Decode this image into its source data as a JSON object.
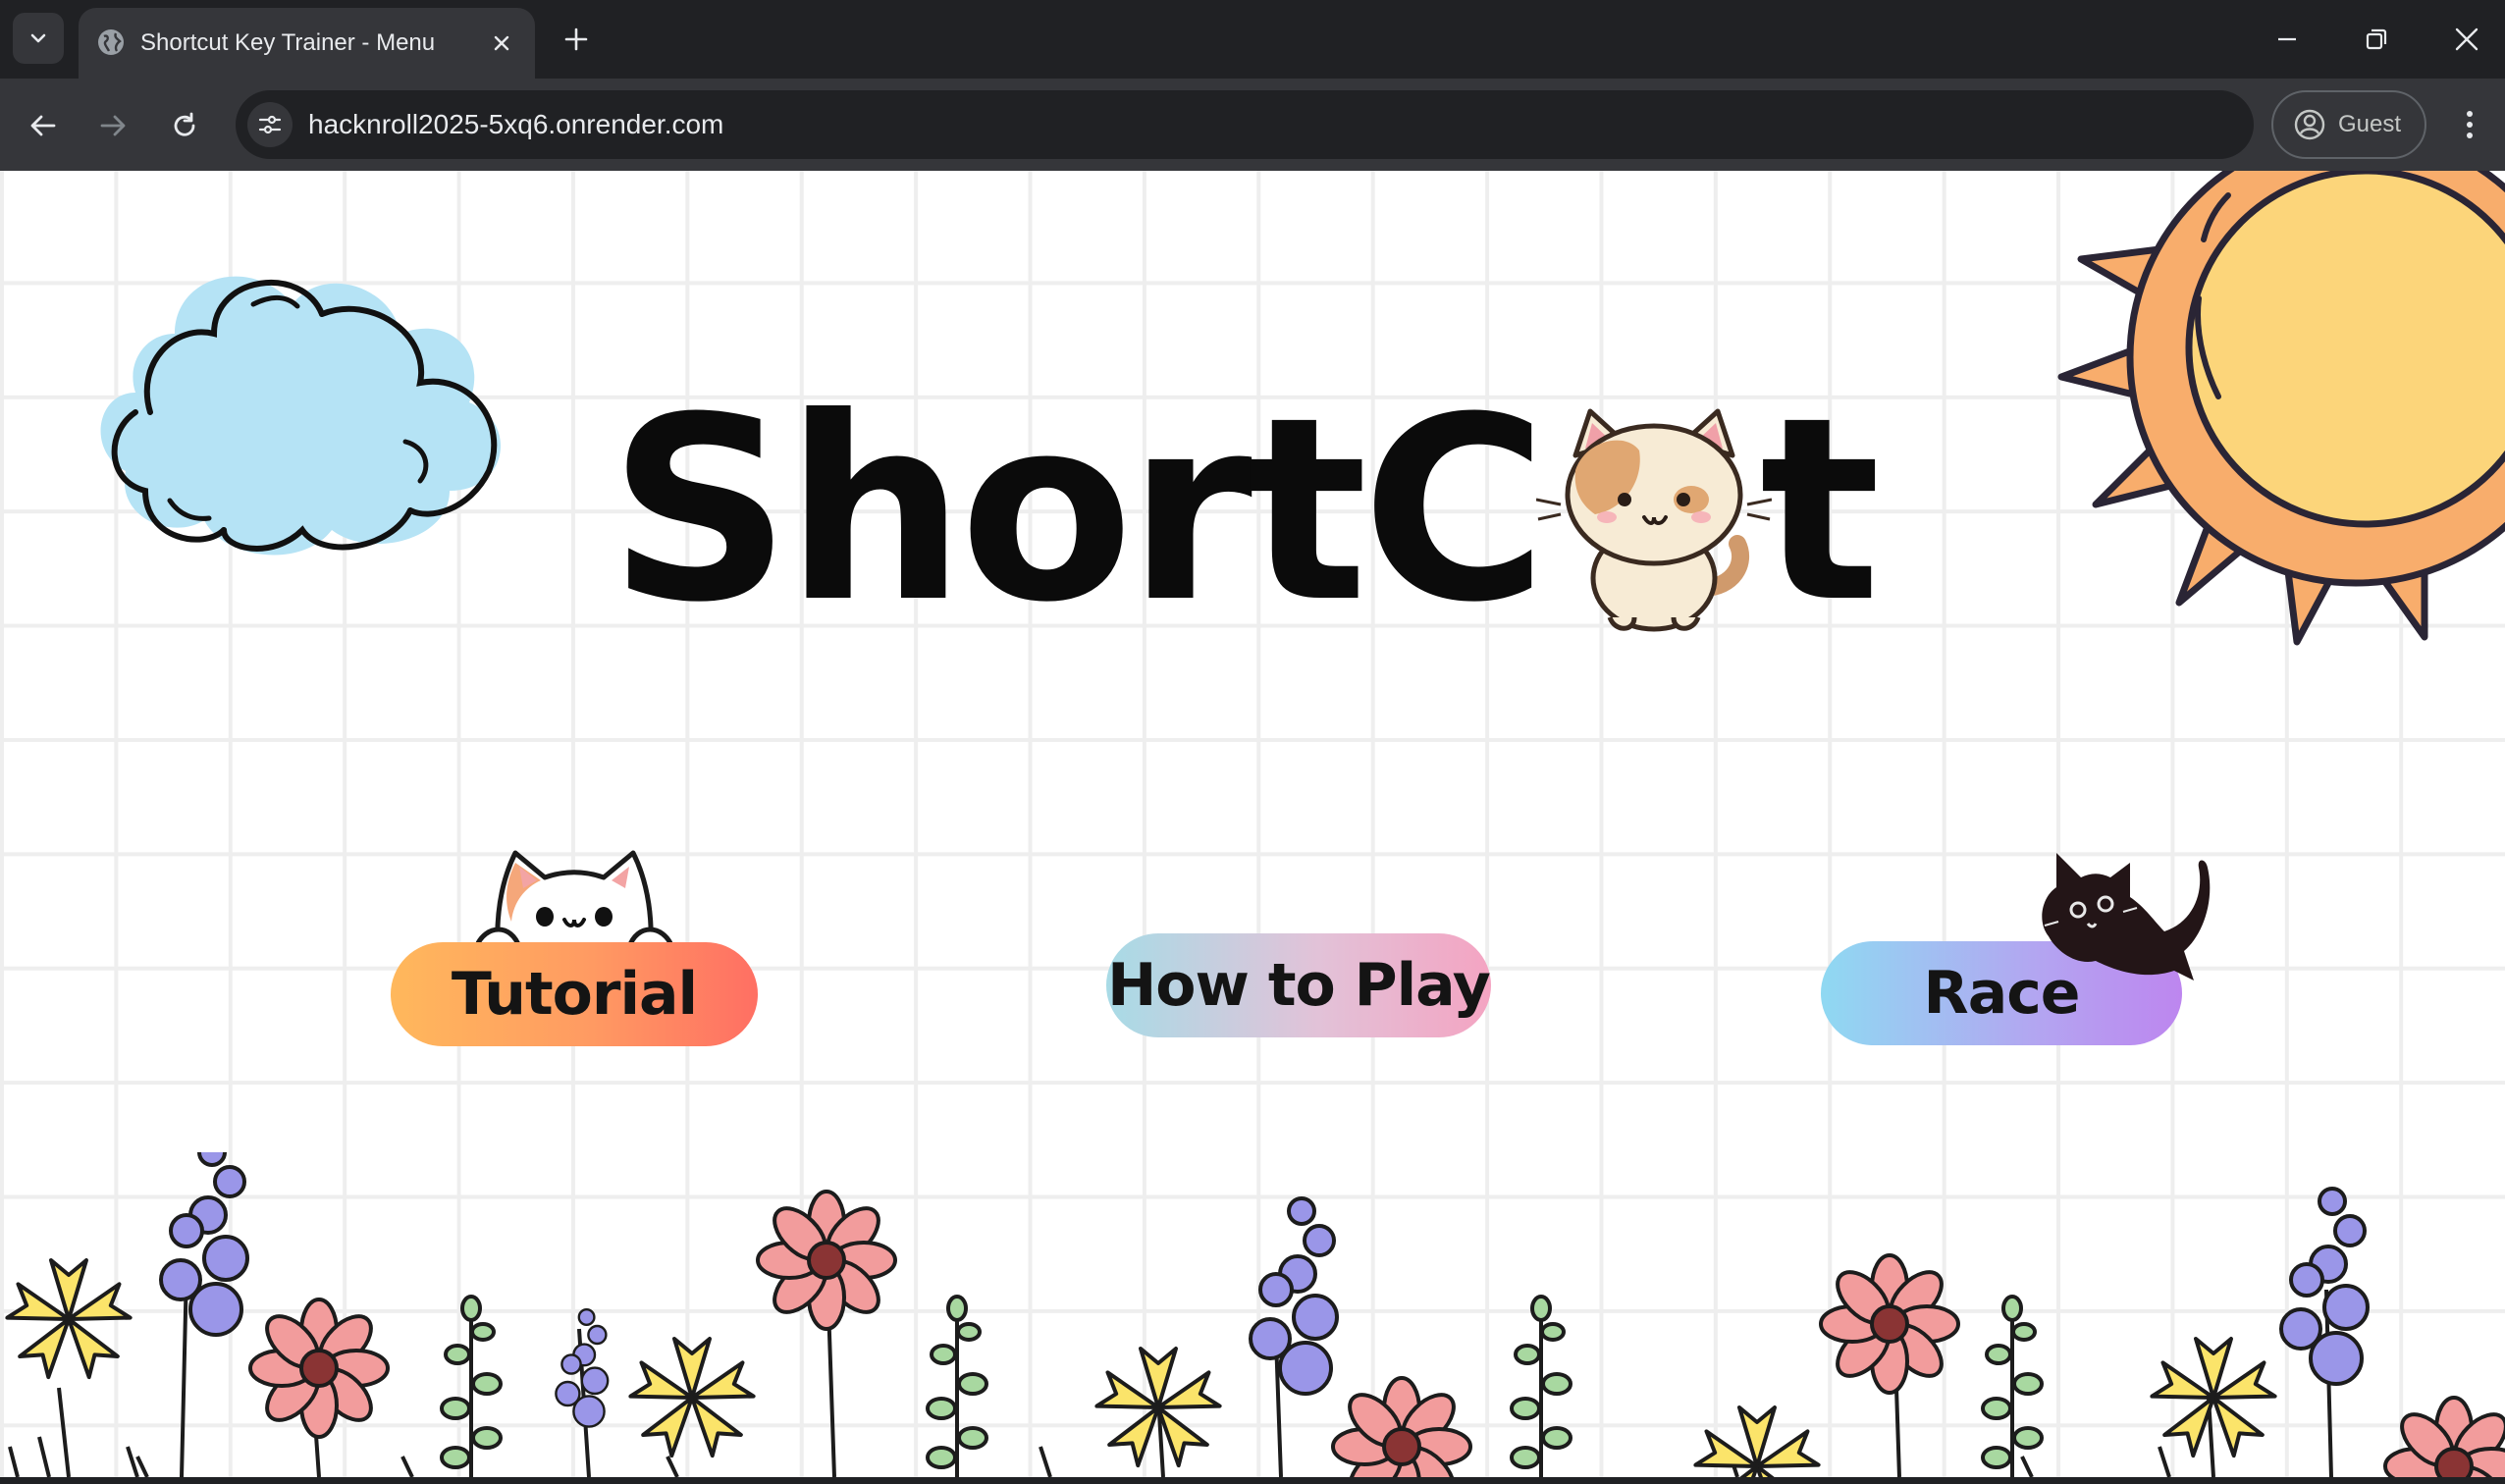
{
  "browser": {
    "tab": {
      "title": "Shortcut Key Trainer - Menu"
    },
    "address_bar": {
      "url": "hacknroll2025-5xq6.onrender.com"
    },
    "profile": {
      "label": "Guest"
    }
  },
  "page": {
    "logo": {
      "text_before_cat": "ShortC",
      "text_after_cat": "t"
    },
    "buttons": {
      "tutorial": "Tutorial",
      "how_to_play": "How to Play",
      "race": "Race"
    }
  },
  "colors": {
    "chrome_dark": "#202124",
    "chrome_mid": "#35363a",
    "grid_line": "#eeeeee",
    "cloud_blue": "#b5e3f5",
    "sun_yellow": "#fcd57a",
    "sun_orange": "#f8ad6c",
    "petal_pink": "#f29c9c",
    "petal_yellow": "#fbe46a",
    "berry_purple": "#9a96e8",
    "leaf_green": "#a8d8a0"
  },
  "icons": [
    "tab-search-icon",
    "globe-icon",
    "close-icon",
    "plus-icon",
    "minimize-icon",
    "restore-icon",
    "back-icon",
    "forward-icon",
    "reload-icon",
    "site-settings-icon",
    "profile-icon",
    "more-vert-icon"
  ]
}
